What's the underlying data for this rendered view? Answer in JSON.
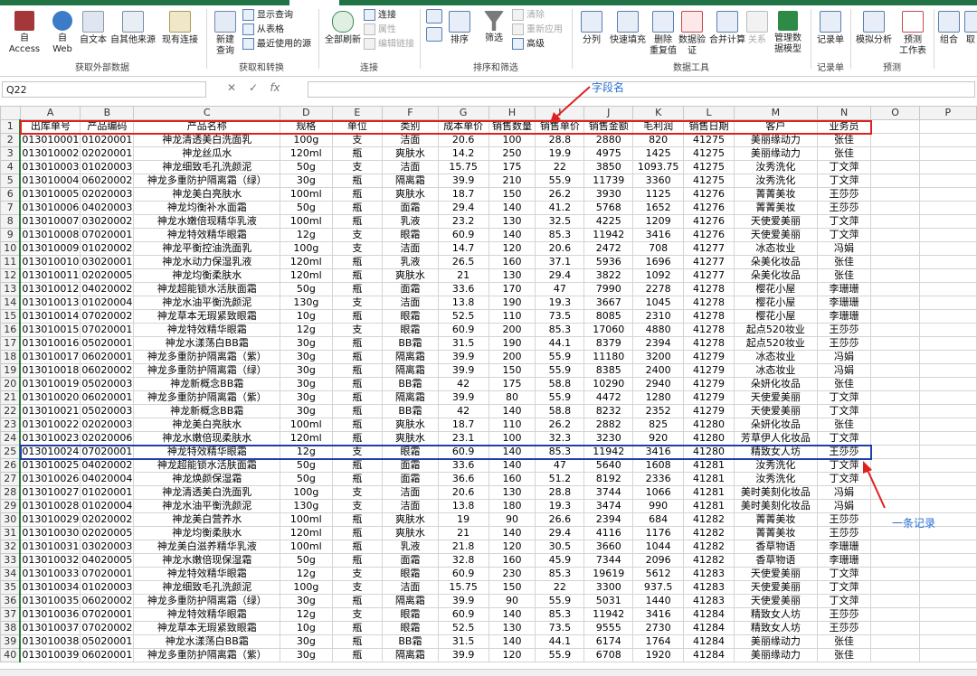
{
  "ribbon": {
    "groups": {
      "external": "获取外部数据",
      "transform": "获取和转换",
      "connections": "连接",
      "sortfilter": "排序和筛选",
      "datatools": "数据工具",
      "records": "记录单",
      "forecast": "预测"
    },
    "buttons": {
      "access": "自 Access",
      "web1": "自",
      "web2": "Web",
      "text": "自文本",
      "othersrc": "自其他来源",
      "existing": "现有连接",
      "newquery1": "新建",
      "newquery2": "查询",
      "showquery": "显示查询",
      "fromtable": "从表格",
      "recentsrc": "最近使用的源",
      "refreshall": "全部刷新",
      "conn": "连接",
      "props": "属性",
      "editlinks": "编辑链接",
      "sort": "排序",
      "filter": "筛选",
      "clear": "清除",
      "reapply": "重新应用",
      "advanced": "高级",
      "split": "分列",
      "flashfill": "快速填充",
      "removedup1": "删除",
      "removedup2": "重复值",
      "validation1": "数据验",
      "validation2": "证",
      "consolidate": "合并计算",
      "relations": "关系",
      "datamodel1": "管理数",
      "datamodel2": "据模型",
      "recordsheet": "记录单",
      "whatif": "模拟分析",
      "forecast1": "预测",
      "forecast2": "工作表",
      "group": "组合",
      "ungroup": "取"
    }
  },
  "formula_bar": {
    "name_box": "Q22",
    "fx": "fx"
  },
  "annotations": {
    "fields": "字段名",
    "record": "一条记录"
  },
  "columns": [
    "",
    "A",
    "B",
    "C",
    "D",
    "E",
    "F",
    "G",
    "H",
    "I",
    "J",
    "K",
    "L",
    "M",
    "N",
    "O",
    "P"
  ],
  "headers": [
    "出库单号",
    "产品编码",
    "产品名称",
    "规格",
    "单位",
    "类别",
    "成本单价",
    "销售数量",
    "销售单价",
    "销售金额",
    "毛利润",
    "销售日期",
    "客户",
    "业务员"
  ],
  "rows": [
    [
      "013010001",
      "01020001",
      "神龙清透美白洗面乳",
      "100g",
      "支",
      "洁面",
      "20.6",
      "100",
      "28.8",
      "2880",
      "820",
      "41275",
      "美丽缘动力",
      "张佳"
    ],
    [
      "013010002",
      "02020001",
      "神龙丝瓜水",
      "120ml",
      "瓶",
      "爽肤水",
      "14.2",
      "250",
      "19.9",
      "4975",
      "1425",
      "41275",
      "美丽缘动力",
      "张佳"
    ],
    [
      "013010003",
      "01020003",
      "神龙细致毛孔洗颜泥",
      "50g",
      "支",
      "洁面",
      "15.75",
      "175",
      "22",
      "3850",
      "1093.75",
      "41275",
      "汝秀洗化",
      "丁文萍"
    ],
    [
      "013010004",
      "06020002",
      "神龙多重防护隔离霜（绿）",
      "30g",
      "瓶",
      "隔离霜",
      "39.9",
      "210",
      "55.9",
      "11739",
      "3360",
      "41275",
      "汝秀洗化",
      "丁文萍"
    ],
    [
      "013010005",
      "02020003",
      "神龙美白亮肤水",
      "100ml",
      "瓶",
      "爽肤水",
      "18.7",
      "150",
      "26.2",
      "3930",
      "1125",
      "41276",
      "菁菁美妆",
      "王莎莎"
    ],
    [
      "013010006",
      "04020003",
      "神龙均衡补水面霜",
      "50g",
      "瓶",
      "面霜",
      "29.4",
      "140",
      "41.2",
      "5768",
      "1652",
      "41276",
      "菁菁美妆",
      "王莎莎"
    ],
    [
      "013010007",
      "03020002",
      "神龙水嫩倍现精华乳液",
      "100ml",
      "瓶",
      "乳液",
      "23.2",
      "130",
      "32.5",
      "4225",
      "1209",
      "41276",
      "天使爱美丽",
      "丁文萍"
    ],
    [
      "013010008",
      "07020001",
      "神龙特效精华眼霜",
      "12g",
      "支",
      "眼霜",
      "60.9",
      "140",
      "85.3",
      "11942",
      "3416",
      "41276",
      "天使爱美丽",
      "丁文萍"
    ],
    [
      "013010009",
      "01020002",
      "神龙平衡控油洗面乳",
      "100g",
      "支",
      "洁面",
      "14.7",
      "120",
      "20.6",
      "2472",
      "708",
      "41277",
      "冰态妆业",
      "冯娟"
    ],
    [
      "013010010",
      "03020001",
      "神龙水动力保湿乳液",
      "120ml",
      "瓶",
      "乳液",
      "26.5",
      "160",
      "37.1",
      "5936",
      "1696",
      "41277",
      "朵美化妆品",
      "张佳"
    ],
    [
      "013010011",
      "02020005",
      "神龙均衡柔肤水",
      "120ml",
      "瓶",
      "爽肤水",
      "21",
      "130",
      "29.4",
      "3822",
      "1092",
      "41277",
      "朵美化妆品",
      "张佳"
    ],
    [
      "013010012",
      "04020002",
      "神龙超能锁水活肤面霜",
      "50g",
      "瓶",
      "面霜",
      "33.6",
      "170",
      "47",
      "7990",
      "2278",
      "41278",
      "樱花小屋",
      "李珊珊"
    ],
    [
      "013010013",
      "01020004",
      "神龙水油平衡洗颜泥",
      "130g",
      "支",
      "洁面",
      "13.8",
      "190",
      "19.3",
      "3667",
      "1045",
      "41278",
      "樱花小屋",
      "李珊珊"
    ],
    [
      "013010014",
      "07020002",
      "神龙草本无瑕紧致眼霜",
      "10g",
      "瓶",
      "眼霜",
      "52.5",
      "110",
      "73.5",
      "8085",
      "2310",
      "41278",
      "樱花小屋",
      "李珊珊"
    ],
    [
      "013010015",
      "07020001",
      "神龙特效精华眼霜",
      "12g",
      "支",
      "眼霜",
      "60.9",
      "200",
      "85.3",
      "17060",
      "4880",
      "41278",
      "起点520妆业",
      "王莎莎"
    ],
    [
      "013010016",
      "05020001",
      "神龙水漾荡白BB霜",
      "30g",
      "瓶",
      "BB霜",
      "31.5",
      "190",
      "44.1",
      "8379",
      "2394",
      "41278",
      "起点520妆业",
      "王莎莎"
    ],
    [
      "013010017",
      "06020001",
      "神龙多重防护隔离霜（紫）",
      "30g",
      "瓶",
      "隔离霜",
      "39.9",
      "200",
      "55.9",
      "11180",
      "3200",
      "41279",
      "冰态妆业",
      "冯娟"
    ],
    [
      "013010018",
      "06020002",
      "神龙多重防护隔离霜（绿）",
      "30g",
      "瓶",
      "隔离霜",
      "39.9",
      "150",
      "55.9",
      "8385",
      "2400",
      "41279",
      "冰态妆业",
      "冯娟"
    ],
    [
      "013010019",
      "05020003",
      "神龙新概念BB霜",
      "30g",
      "瓶",
      "BB霜",
      "42",
      "175",
      "58.8",
      "10290",
      "2940",
      "41279",
      "朵妍化妆品",
      "张佳"
    ],
    [
      "013010020",
      "06020001",
      "神龙多重防护隔离霜（紫）",
      "30g",
      "瓶",
      "隔离霜",
      "39.9",
      "80",
      "55.9",
      "4472",
      "1280",
      "41279",
      "天使爱美丽",
      "丁文萍"
    ],
    [
      "013010021",
      "05020003",
      "神龙新概念BB霜",
      "30g",
      "瓶",
      "BB霜",
      "42",
      "140",
      "58.8",
      "8232",
      "2352",
      "41279",
      "天使爱美丽",
      "丁文萍"
    ],
    [
      "013010022",
      "02020003",
      "神龙美白亮肤水",
      "100ml",
      "瓶",
      "爽肤水",
      "18.7",
      "110",
      "26.2",
      "2882",
      "825",
      "41280",
      "朵妍化妆品",
      "张佳"
    ],
    [
      "013010023",
      "02020006",
      "神龙水嫩倍现柔肤水",
      "120ml",
      "瓶",
      "爽肤水",
      "23.1",
      "100",
      "32.3",
      "3230",
      "920",
      "41280",
      "芳草伊人化妆品",
      "丁文萍"
    ],
    [
      "013010024",
      "07020001",
      "神龙特效精华眼霜",
      "12g",
      "支",
      "眼霜",
      "60.9",
      "140",
      "85.3",
      "11942",
      "3416",
      "41280",
      "精致女人坊",
      "王莎莎"
    ],
    [
      "013010025",
      "04020002",
      "神龙超能锁水活肤面霜",
      "50g",
      "瓶",
      "面霜",
      "33.6",
      "140",
      "47",
      "5640",
      "1608",
      "41281",
      "汝秀洗化",
      "丁文萍"
    ],
    [
      "013010026",
      "04020004",
      "神龙焕颜保湿霜",
      "50g",
      "瓶",
      "面霜",
      "36.6",
      "160",
      "51.2",
      "8192",
      "2336",
      "41281",
      "汝秀洗化",
      "丁文萍"
    ],
    [
      "013010027",
      "01020001",
      "神龙清透美白洗面乳",
      "100g",
      "支",
      "洁面",
      "20.6",
      "130",
      "28.8",
      "3744",
      "1066",
      "41281",
      "美时美刻化妆品",
      "冯娟"
    ],
    [
      "013010028",
      "01020004",
      "神龙水油平衡洗颜泥",
      "130g",
      "支",
      "洁面",
      "13.8",
      "180",
      "19.3",
      "3474",
      "990",
      "41281",
      "美时美刻化妆品",
      "冯娟"
    ],
    [
      "013010029",
      "02020002",
      "神龙美白营养水",
      "100ml",
      "瓶",
      "爽肤水",
      "19",
      "90",
      "26.6",
      "2394",
      "684",
      "41282",
      "菁菁美妆",
      "王莎莎"
    ],
    [
      "013010030",
      "02020005",
      "神龙均衡柔肤水",
      "120ml",
      "瓶",
      "爽肤水",
      "21",
      "140",
      "29.4",
      "4116",
      "1176",
      "41282",
      "菁菁美妆",
      "王莎莎"
    ],
    [
      "013010031",
      "03020003",
      "神龙美白滋养精华乳液",
      "100ml",
      "瓶",
      "乳液",
      "21.8",
      "120",
      "30.5",
      "3660",
      "1044",
      "41282",
      "香草物语",
      "李珊珊"
    ],
    [
      "013010032",
      "04020005",
      "神龙水嫩倍现保湿霜",
      "50g",
      "瓶",
      "面霜",
      "32.8",
      "160",
      "45.9",
      "7344",
      "2096",
      "41282",
      "香草物语",
      "李珊珊"
    ],
    [
      "013010033",
      "07020001",
      "神龙特效精华眼霜",
      "12g",
      "支",
      "眼霜",
      "60.9",
      "230",
      "85.3",
      "19619",
      "5612",
      "41283",
      "天使爱美丽",
      "丁文萍"
    ],
    [
      "013010034",
      "01020003",
      "神龙细致毛孔洗颜泥",
      "100g",
      "支",
      "洁面",
      "15.75",
      "150",
      "22",
      "3300",
      "937.5",
      "41283",
      "天使爱美丽",
      "丁文萍"
    ],
    [
      "013010035",
      "06020002",
      "神龙多重防护隔离霜（绿）",
      "30g",
      "瓶",
      "隔离霜",
      "39.9",
      "90",
      "55.9",
      "5031",
      "1440",
      "41283",
      "天使爱美丽",
      "丁文萍"
    ],
    [
      "013010036",
      "07020001",
      "神龙特效精华眼霜",
      "12g",
      "支",
      "眼霜",
      "60.9",
      "140",
      "85.3",
      "11942",
      "3416",
      "41284",
      "精致女人坊",
      "王莎莎"
    ],
    [
      "013010037",
      "07020002",
      "神龙草本无瑕紧致眼霜",
      "10g",
      "瓶",
      "眼霜",
      "52.5",
      "130",
      "73.5",
      "9555",
      "2730",
      "41284",
      "精致女人坊",
      "王莎莎"
    ],
    [
      "013010038",
      "05020001",
      "神龙水漾荡白BB霜",
      "30g",
      "瓶",
      "BB霜",
      "31.5",
      "140",
      "44.1",
      "6174",
      "1764",
      "41284",
      "美丽缘动力",
      "张佳"
    ],
    [
      "013010039",
      "06020001",
      "神龙多重防护隔离霜（紫）",
      "30g",
      "瓶",
      "隔离霜",
      "39.9",
      "120",
      "55.9",
      "6708",
      "1920",
      "41284",
      "美丽缘动力",
      "张佳"
    ]
  ],
  "colors": {
    "accent": "#217346",
    "field_box": "#e02020",
    "record_box": "#1f3fa8",
    "annotation": "#2a6fd4"
  }
}
